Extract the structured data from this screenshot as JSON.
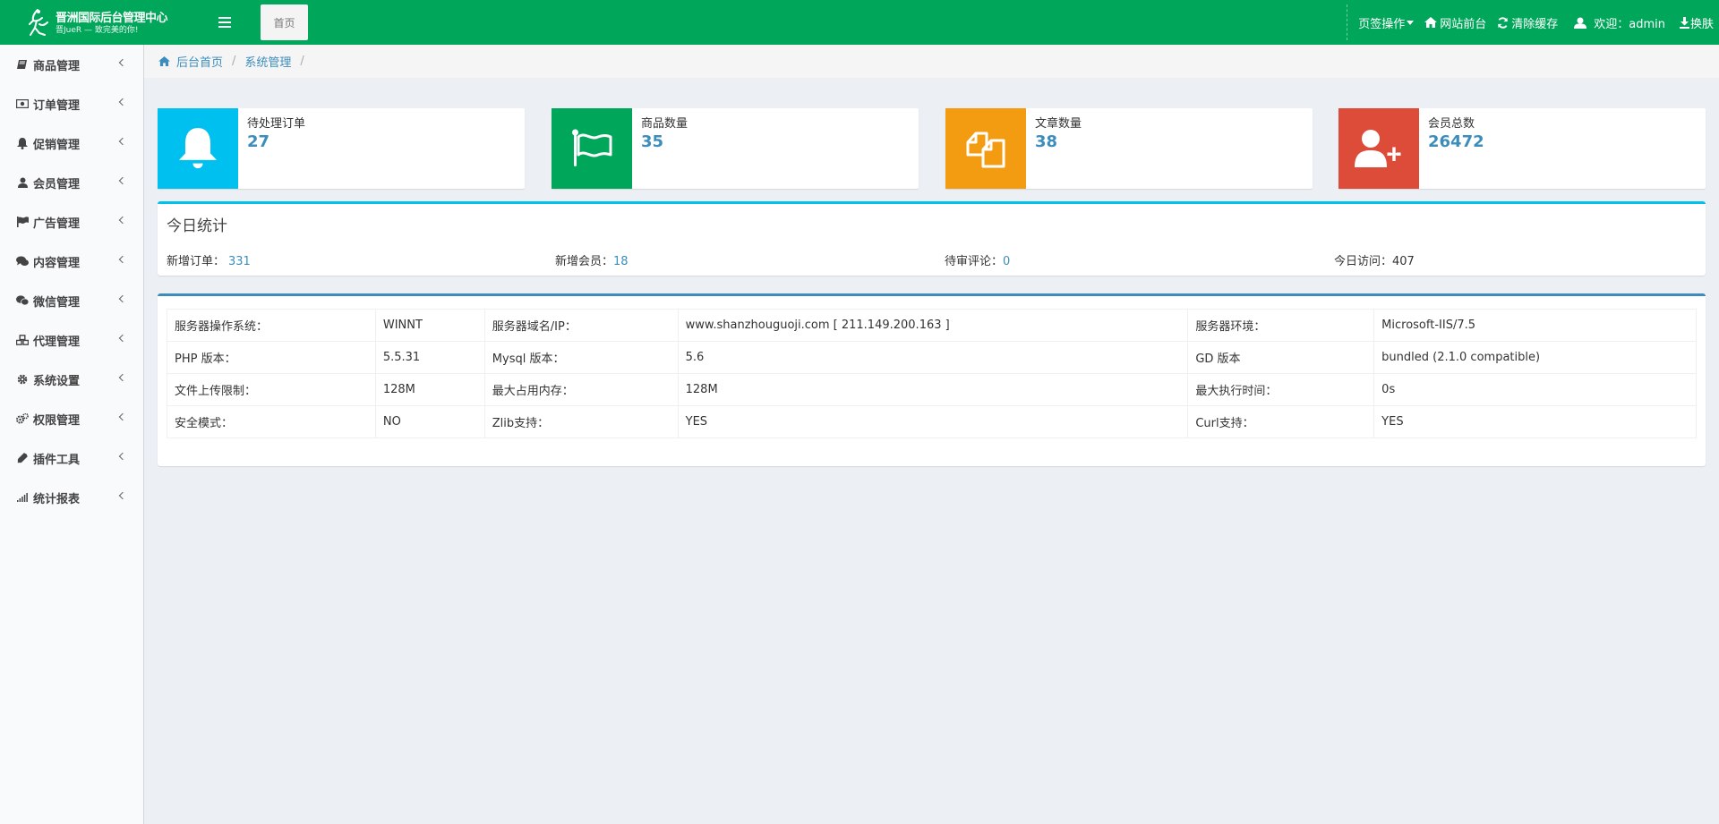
{
  "header": {
    "logo_title": "晋洲国际后台管理中心",
    "logo_subtitle": "晋JueR — 致完美的你!",
    "home_tab": "首页",
    "nav": {
      "tab_ops": "页签操作",
      "site_front": "网站前台",
      "clear_cache": "清除缓存",
      "welcome": "欢迎：admin",
      "switch_skin": "换肤"
    }
  },
  "sidebar": {
    "items": [
      {
        "label": "商品管理",
        "icon": "book-icon"
      },
      {
        "label": "订单管理",
        "icon": "money-icon"
      },
      {
        "label": "促销管理",
        "icon": "bell-icon"
      },
      {
        "label": "会员管理",
        "icon": "user-icon"
      },
      {
        "label": "广告管理",
        "icon": "flag-icon"
      },
      {
        "label": "内容管理",
        "icon": "comments-icon"
      },
      {
        "label": "微信管理",
        "icon": "wechat-icon"
      },
      {
        "label": "代理管理",
        "icon": "cubes-icon"
      },
      {
        "label": "系统设置",
        "icon": "gear-icon"
      },
      {
        "label": "权限管理",
        "icon": "gears-icon"
      },
      {
        "label": "插件工具",
        "icon": "plug-icon"
      },
      {
        "label": "统计报表",
        "icon": "signal-icon"
      }
    ]
  },
  "breadcrumb": {
    "home": "后台首页",
    "current": "系统管理",
    "separator": "/"
  },
  "info_boxes": [
    {
      "label": "待处理订单",
      "value": "27",
      "color": "#00c0ef",
      "icon": "bell-icon"
    },
    {
      "label": "商品数量",
      "value": "35",
      "color": "#00a65a",
      "icon": "flag-icon"
    },
    {
      "label": "文章数量",
      "value": "38",
      "color": "#f39c12",
      "icon": "files-icon"
    },
    {
      "label": "会员总数",
      "value": "26472",
      "color": "#dd4b39",
      "icon": "user-plus-icon"
    }
  ],
  "today": {
    "title": "今日统计",
    "stats": [
      {
        "label": "新增订单：",
        "value": "331"
      },
      {
        "label": "新增会员：",
        "value": "18"
      },
      {
        "label": "待审评论：",
        "value": "0"
      },
      {
        "label": "今日访问：",
        "value": "407"
      }
    ]
  },
  "server": {
    "rows": [
      [
        "服务器操作系统：",
        "WINNT",
        "服务器域名/IP：",
        "www.shanzhouguoji.com [ 211.149.200.163 ]",
        "服务器环境：",
        "Microsoft-IIS/7.5"
      ],
      [
        "PHP 版本：",
        "5.5.31",
        "Mysql 版本：",
        "5.6",
        "GD 版本",
        "bundled (2.1.0 compatible)"
      ],
      [
        "文件上传限制：",
        "128M",
        "最大占用内存：",
        "128M",
        "最大执行时间：",
        "0s"
      ],
      [
        "安全模式：",
        "NO",
        "Zlib支持：",
        "YES",
        "Curl支持：",
        "YES"
      ]
    ]
  },
  "colors": {
    "header_bg": "#00a65a",
    "link": "#3c8dbc",
    "content_bg": "#ecf0f5"
  }
}
